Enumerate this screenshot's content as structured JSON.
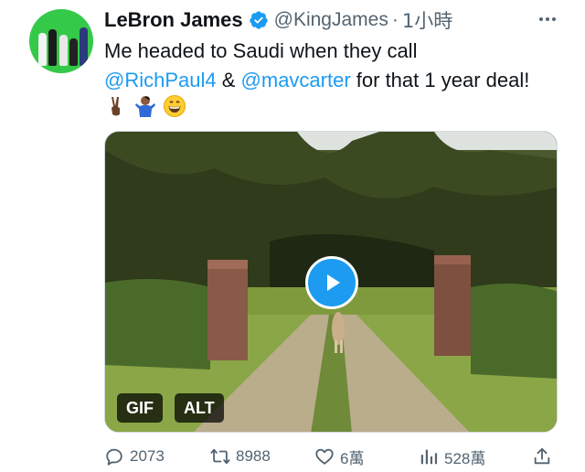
{
  "tweet": {
    "author_name": "LeBron James",
    "handle": "@KingJames",
    "separator": "·",
    "time": "1小時",
    "text_part1": "Me headed to Saudi when they call",
    "mention1": "@RichPaul4",
    "amp": " & ",
    "mention2": "@mavcarter",
    "text_part2": " for that 1 year deal!",
    "emojis": [
      "victory-hand-icon",
      "person-shrugging-icon",
      "grinning-face-icon"
    ]
  },
  "media": {
    "badge_gif": "GIF",
    "badge_alt": "ALT"
  },
  "actions": {
    "replies": "2073",
    "retweets": "8988",
    "likes": "6萬",
    "views": "528萬"
  },
  "colors": {
    "accent": "#1d9bf0",
    "text": "#0f1419",
    "secondary": "#536471",
    "avatar_bg": "#35c94a"
  }
}
